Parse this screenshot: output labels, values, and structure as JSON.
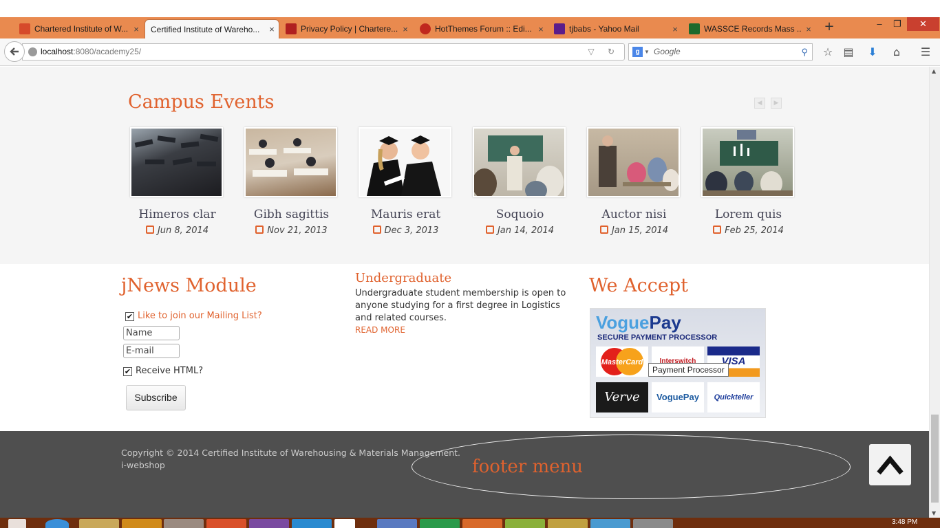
{
  "browser": {
    "tabs": [
      {
        "label": "Chartered Institute of W...",
        "close": "×",
        "active": false,
        "favicon_color": "#d64a2a"
      },
      {
        "label": "Certified Institute of Wareho...",
        "close": "×",
        "active": true,
        "favicon_color": ""
      },
      {
        "label": "Privacy Policy | Chartere...",
        "close": "×",
        "active": false,
        "favicon_color": "#b02020"
      },
      {
        "label": "HotThemes Forum :: Edi...",
        "close": "×",
        "active": false,
        "favicon_color": "#c0281e"
      },
      {
        "label": "tjbabs - Yahoo Mail",
        "close": "×",
        "active": false,
        "favicon_color": "#5b1d8a"
      },
      {
        "label": "WASSCE Records Mass ...",
        "close": "×",
        "active": false,
        "favicon_color": "#1f6a2c"
      }
    ],
    "new_tab": "+",
    "window_buttons": {
      "minimize": "–",
      "restore": "❐",
      "close": "✕"
    },
    "url": {
      "host": "localhost",
      "rest": ":8080/academy25/"
    },
    "search": {
      "engine": "g",
      "placeholder": "Google"
    },
    "url_icons": "▽ ↻"
  },
  "events": {
    "title": "Campus Events",
    "prev": "◀",
    "next": "▶",
    "items": [
      {
        "title": "Himeros clar",
        "date": "Jun 8, 2014"
      },
      {
        "title": "Gibh sagittis",
        "date": "Nov 21, 2013"
      },
      {
        "title": "Mauris erat",
        "date": "Dec 3, 2013"
      },
      {
        "title": "Soquoio",
        "date": "Jan 14, 2014"
      },
      {
        "title": "Auctor nisi",
        "date": "Jan 15, 2014"
      },
      {
        "title": "Lorem quis",
        "date": "Feb 25, 2014"
      }
    ]
  },
  "jnews": {
    "title": "jNews Module",
    "mailing_label": "Like to join our Mailing List?",
    "name_placeholder": "Name",
    "email_placeholder": "E-mail",
    "receive_label": "Receive HTML?",
    "subscribe_label": "Subscribe",
    "check": "✔"
  },
  "undergrad": {
    "title": "Undergraduate",
    "text": "Undergraduate student membership is open to anyone studying for a first degree in Logistics and related courses.",
    "more": "READ MORE"
  },
  "accept": {
    "title": "We Accept",
    "logo_vogue": "Vogue",
    "logo_pay": "Pay",
    "subtitle": "SECURE PAYMENT PROCESSOR",
    "cards": [
      "MasterCard",
      "Interswitch",
      "VISA",
      "Verve",
      "VoguePay",
      "Quickteller"
    ],
    "tooltip": "Payment Processor"
  },
  "footer": {
    "copyright": "Copyright © 2014 Certified Institute of Warehousing & Materials Management.",
    "credit": "i-webshop",
    "menu_label": "footer menu"
  },
  "taskbar": {
    "clock": "3:48 PM"
  },
  "colors": {
    "accent": "#e0622e",
    "tabbar": "#e98a4f",
    "footer": "#4f4f4f",
    "taskbar": "#6e2e0e"
  }
}
